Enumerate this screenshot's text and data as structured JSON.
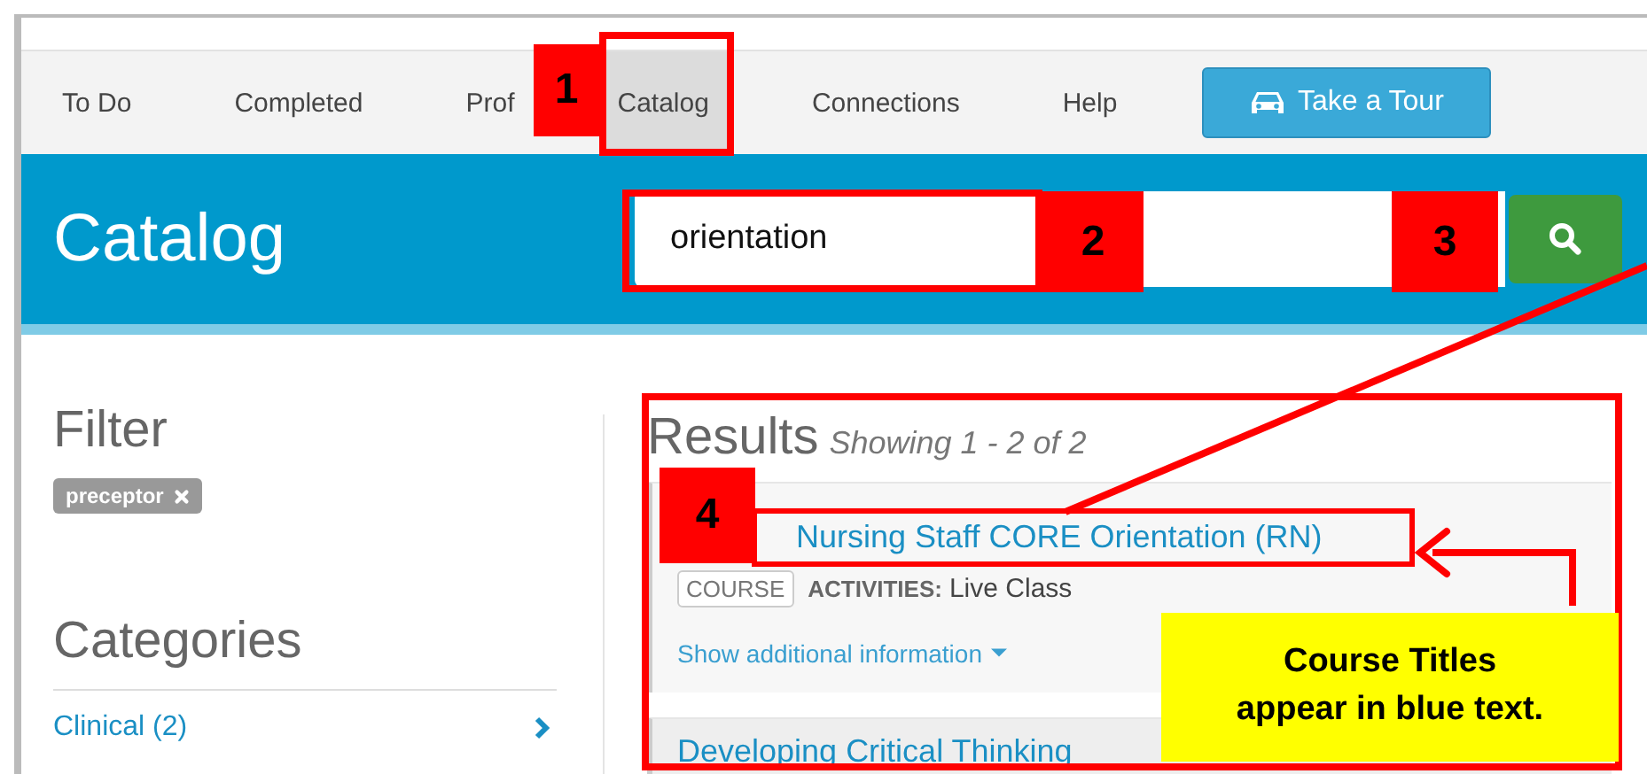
{
  "nav": {
    "tabs": [
      {
        "label": "To Do",
        "selected": false
      },
      {
        "label": "Completed",
        "selected": false
      },
      {
        "label": "Prof",
        "selected": false
      },
      {
        "label": "Catalog",
        "selected": true
      },
      {
        "label": "Connections",
        "selected": false
      },
      {
        "label": "Help",
        "selected": false
      }
    ],
    "tour_button": "Take a Tour"
  },
  "header": {
    "title": "Catalog",
    "search": {
      "value": "orientation"
    }
  },
  "filter": {
    "title": "Filter",
    "tags": [
      "preceptor"
    ]
  },
  "categories": {
    "title": "Categories",
    "items": [
      {
        "label": "Clinical (2)"
      }
    ]
  },
  "results": {
    "title": "Results",
    "summary": "Showing 1 - 2 of 2",
    "items": [
      {
        "title": "Nursing Staff CORE Orientation (RN)",
        "type": "COURSE",
        "activities_label": "ACTIVITIES:",
        "activities": "Live Class",
        "more": "Show additional information"
      },
      {
        "title": "Developing Critical Thinking"
      }
    ]
  },
  "annotations": {
    "markers": [
      "1",
      "2",
      "3",
      "4"
    ],
    "callout": "Course Titles appear in blue text."
  }
}
